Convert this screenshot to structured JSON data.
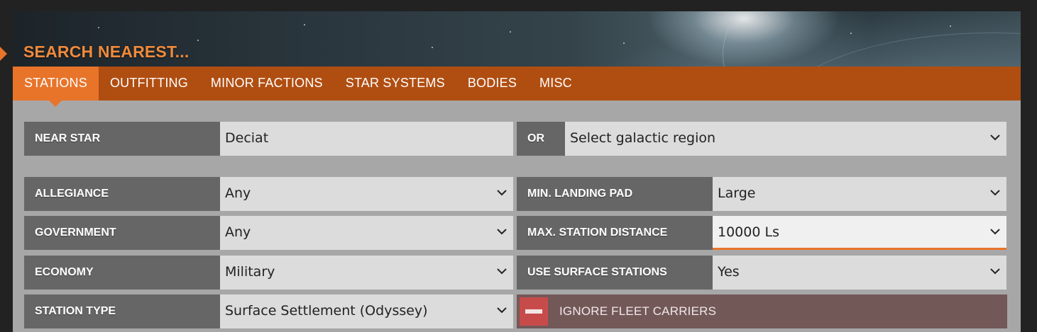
{
  "header": {
    "title": "SEARCH NEAREST..."
  },
  "tabs": [
    {
      "label": "STATIONS",
      "active": true
    },
    {
      "label": "OUTFITTING",
      "active": false
    },
    {
      "label": "MINOR FACTIONS",
      "active": false
    },
    {
      "label": "STAR SYSTEMS",
      "active": false
    },
    {
      "label": "BODIES",
      "active": false
    },
    {
      "label": "MISC",
      "active": false
    }
  ],
  "search": {
    "near_star_label": "NEAR STAR",
    "near_star_value": "Deciat",
    "or_label": "OR",
    "region_value": "Select galactic region"
  },
  "filters": {
    "allegiance": {
      "label": "ALLEGIANCE",
      "value": "Any"
    },
    "government": {
      "label": "GOVERNMENT",
      "value": "Any"
    },
    "economy": {
      "label": "ECONOMY",
      "value": "Military"
    },
    "station_type": {
      "label": "STATION TYPE",
      "value": "Surface Settlement (Odyssey)"
    },
    "min_landing_pad": {
      "label": "MIN. LANDING PAD",
      "value": "Large"
    },
    "max_station_distance": {
      "label": "MAX. STATION DISTANCE",
      "value": "10000 Ls"
    },
    "use_surface_stations": {
      "label": "USE SURFACE STATIONS",
      "value": "Yes"
    },
    "ignore_fleet_carriers": {
      "label": "IGNORE FLEET CARRIERS"
    }
  },
  "icons": {
    "chevron": "chevron-down-icon",
    "toggle": "minus-toggle-icon"
  },
  "colors": {
    "accent": "#e8742a",
    "tab_bar": "#b04e12",
    "label_bg": "#666666",
    "field_bg": "#dcdcdc",
    "toggle_off": "#c84b4b"
  }
}
